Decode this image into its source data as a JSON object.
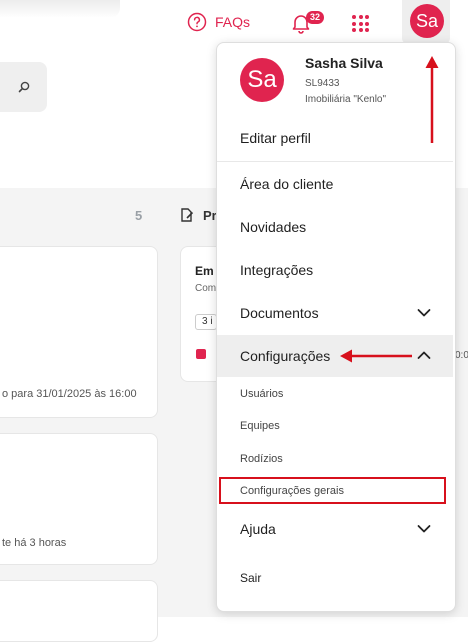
{
  "header": {
    "faq_label": "FAQs",
    "notifications_count": "32",
    "avatar_initials": "Sa"
  },
  "board": {
    "column_count": "5",
    "column_title": "Pr",
    "card1_text": "o para 31/01/2025 às 16:00",
    "card2_text": "te há 3 horas",
    "card4_title": "Em",
    "card4_subtitle": "Com",
    "card4_chip": "3 i",
    "card4_time": "0:0"
  },
  "user_menu": {
    "avatar_initials": "Sa",
    "name": "Sasha Silva",
    "user_id": "SL9433",
    "organization": "Imobiliária \"Kenlo\"",
    "edit_profile": "Editar perfil",
    "items": {
      "client_area": "Área do cliente",
      "news": "Novidades",
      "integrations": "Integrações",
      "documents": "Documentos",
      "settings": "Configurações",
      "help": "Ajuda",
      "logout": "Sair"
    },
    "settings_submenu": {
      "users": "Usuários",
      "teams": "Equipes",
      "rotations": "Rodízios",
      "general_settings": "Configurações gerais"
    }
  },
  "colors": {
    "brand": "#e0244f",
    "annotation": "#d7101c"
  }
}
